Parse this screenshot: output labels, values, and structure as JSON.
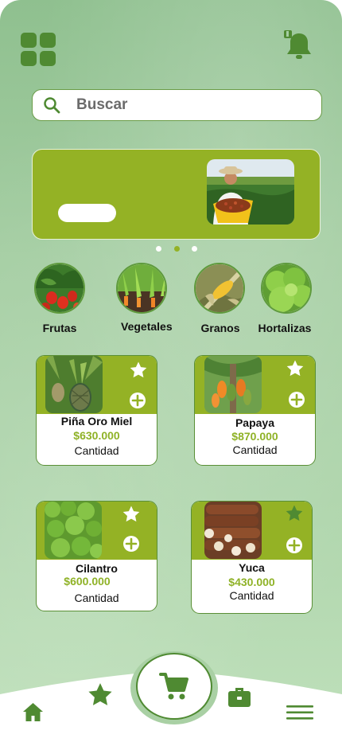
{
  "search": {
    "placeholder": "Buscar"
  },
  "banner": {
    "carousel_active_index": 1,
    "carousel_count": 3
  },
  "categories": [
    {
      "label": "Frutas"
    },
    {
      "label": "Vegetales"
    },
    {
      "label": "Granos"
    },
    {
      "label": "Hortalizas"
    }
  ],
  "products": [
    {
      "name": "Piña Oro Miel",
      "price": "$630.000",
      "qty_label": "Cantidad",
      "favorite": false
    },
    {
      "name": "Papaya",
      "price": "$870.000",
      "qty_label": "Cantidad",
      "favorite": false
    },
    {
      "name": "Cilantro",
      "price": "$600.000",
      "qty_label": "Cantidad",
      "favorite": false
    },
    {
      "name": "Yuca",
      "price": "$430.000",
      "qty_label": "Cantidad",
      "favorite": true
    }
  ],
  "nav": {
    "items": [
      "home-icon",
      "star-icon",
      "cart-icon",
      "briefcase-icon",
      "menu-icon"
    ],
    "active": "cart-icon"
  },
  "colors": {
    "primary_green": "#4f8a32",
    "lime_green": "#94b225",
    "price_green": "#8fb227",
    "background_green": "#a5cea3"
  }
}
